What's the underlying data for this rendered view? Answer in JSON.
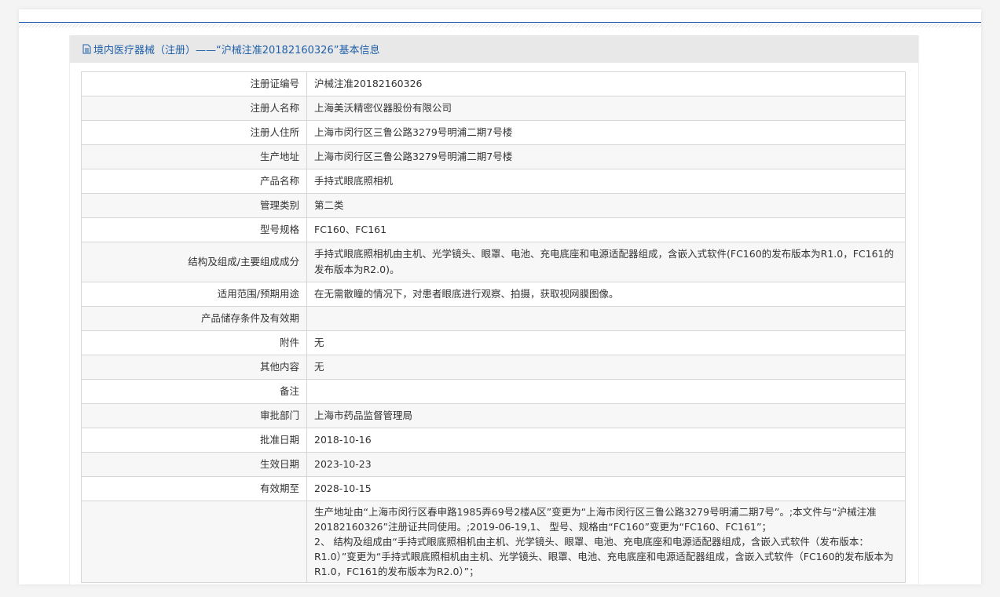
{
  "header": {
    "title": "境内医疗器械（注册）——“沪械注准20182160326”基本信息",
    "icon": "document-icon"
  },
  "rows": [
    {
      "label": "注册证编号",
      "value": "沪械注准20182160326"
    },
    {
      "label": "注册人名称",
      "value": "上海美沃精密仪器股份有限公司"
    },
    {
      "label": "注册人住所",
      "value": "上海市闵行区三鲁公路3279号明浦二期7号楼"
    },
    {
      "label": "生产地址",
      "value": "上海市闵行区三鲁公路3279号明浦二期7号楼"
    },
    {
      "label": "产品名称",
      "value": "手持式眼底照相机"
    },
    {
      "label": "管理类别",
      "value": "第二类"
    },
    {
      "label": "型号规格",
      "value": "FC160、FC161"
    },
    {
      "label": "结构及组成/主要组成成分",
      "value": "手持式眼底照相机由主机、光学镜头、眼罩、电池、充电底座和电源适配器组成，含嵌入式软件(FC160的发布版本为R1.0，FC161的发布版本为R2.0)。"
    },
    {
      "label": "适用范围/预期用途",
      "value": "在无需散瞳的情况下，对患者眼底进行观察、拍摄，获取视网膜图像。"
    },
    {
      "label": "产品储存条件及有效期",
      "value": ""
    },
    {
      "label": "附件",
      "value": "无"
    },
    {
      "label": "其他内容",
      "value": "无"
    },
    {
      "label": "备注",
      "value": ""
    },
    {
      "label": "审批部门",
      "value": "上海市药品监督管理局"
    },
    {
      "label": "批准日期",
      "value": "2018-10-16"
    },
    {
      "label": "生效日期",
      "value": "2023-10-23"
    },
    {
      "label": "有效期至",
      "value": "2028-10-15"
    },
    {
      "label": "",
      "value": "生产地址由“上海市闵行区春申路1985弄69号2楼A区”变更为“上海市闵行区三鲁公路3279号明浦二期7号”。;本文件与“沪械注准20182160326”注册证共同使用。;2019-06-19,1、 型号、规格由“FC160”变更为“FC160、FC161”；\n2、 结构及组成由“手持式眼底照相机由主机、光学镜头、眼罩、电池、充电底座和电源适配器组成，含嵌入式软件（发布版本：R1.0）”变更为“手持式眼底照相机由主机、光学镜头、眼罩、电池、充电底座和电源适配器组成，含嵌入式软件（FC160的发布版本为R1.0，FC161的发布版本为R2.0）”；"
    }
  ]
}
